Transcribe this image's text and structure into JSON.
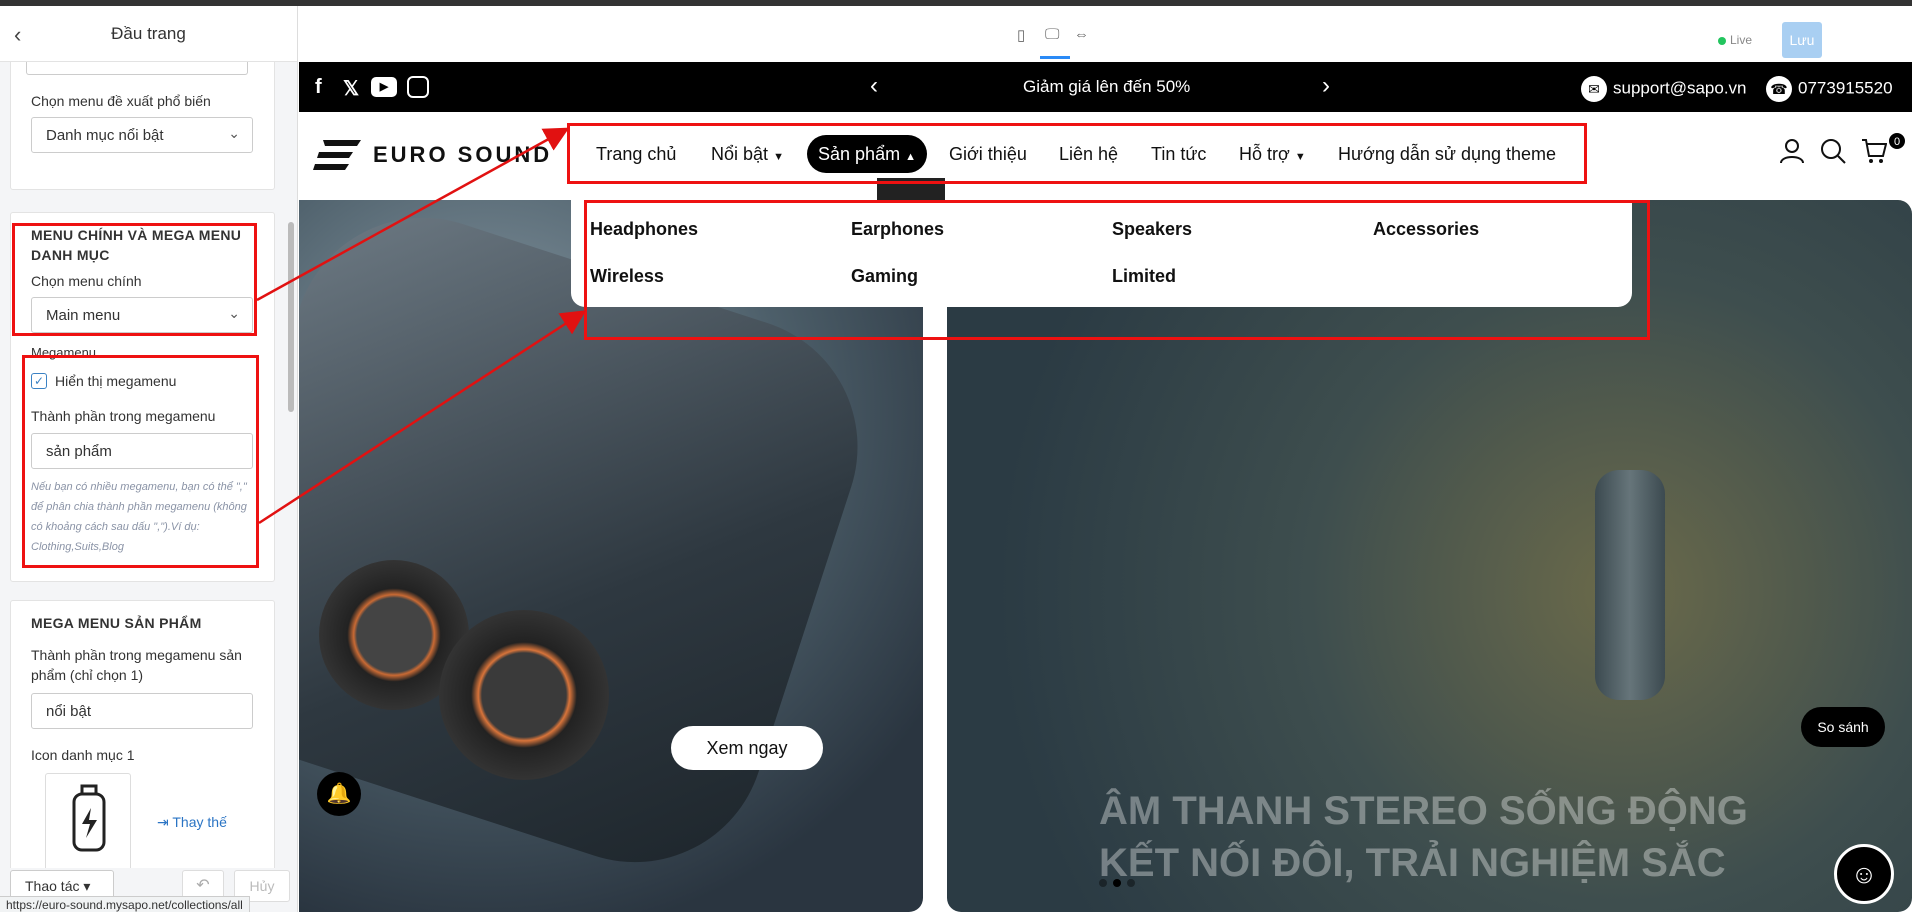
{
  "sidebar": {
    "title": "Đầu trang",
    "suggest_label": "Chọn menu đề xuất phổ biến",
    "suggest_value": "Danh mục nổi bật",
    "main_section_title": "MENU CHÍNH VÀ MEGA MENU DANH MỤC",
    "main_menu_label": "Chọn menu chính",
    "main_menu_value": "Main menu",
    "megamenu_label": "Megamenu",
    "show_megamenu_label": "Hiển thị megamenu",
    "megamenu_components_label": "Thành phần trong megamenu",
    "megamenu_components_value": "sản phẩm",
    "megamenu_hint": "Nếu bạn có nhiều megamenu, bạn có thể \",\" để phân chia thành phần megamenu (không có khoảng cách sau dấu \",\").Ví dụ: Clothing,Suits,Blog",
    "product_section_title": "MEGA MENU SẢN PHẨM",
    "product_components_label": "Thành phần trong megamenu sản phẩm (chỉ chọn 1)",
    "product_components_value": "nổi bật",
    "category_icon_label": "Icon danh mục 1",
    "replace_label": "Thay thế",
    "actions_label": "Thao tác",
    "cancel_label": "Hủy"
  },
  "status_url": "https://euro-sound.mysapo.net/collections/all",
  "toolbar": {
    "live_label": "Live",
    "save_label": "Lưu"
  },
  "store": {
    "promo_text": "Giảm giá lên đến 50%",
    "email": "support@sapo.vn",
    "phone": "0773915520",
    "logo_text": "EURO SOUND",
    "cart_count": "0",
    "nav": [
      "Trang chủ",
      "Nổi bật",
      "Sản phẩm",
      "Giới thiệu",
      "Liên hệ",
      "Tin tức",
      "Hỗ trợ",
      "Hướng dẫn sử dụng theme"
    ],
    "mega_items": [
      "Headphones",
      "Earphones",
      "Speakers",
      "Accessories",
      "Wireless",
      "Gaming",
      "Limited"
    ],
    "hero_button": "Xem ngay",
    "hero_text_line1": "ÂM THANH STEREO SỐNG ĐỘNG",
    "hero_text_line2": "KẾT NỐI ĐÔI, TRẢI NGHIỆM SẮC",
    "compare_label": "So sánh"
  },
  "colors": {
    "annotation": "#e11111",
    "save_button": "#a9cff2",
    "topbar": "#000000"
  }
}
